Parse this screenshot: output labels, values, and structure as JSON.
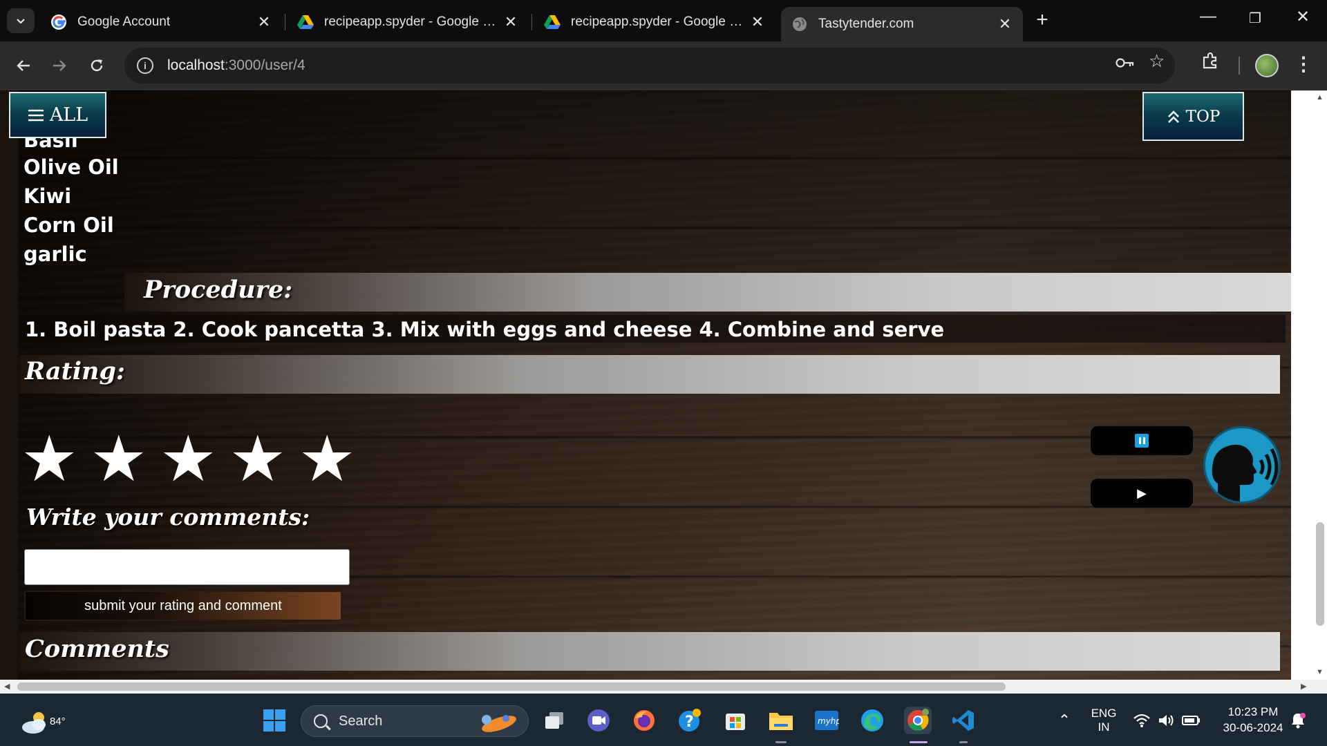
{
  "browser": {
    "tabs": [
      {
        "title": "Google Account",
        "icon": "google-icon"
      },
      {
        "title": "recipeapp.spyder - Google Drive",
        "icon": "google-drive-icon"
      },
      {
        "title": "recipeapp.spyder - Google Drive",
        "icon": "google-drive-icon"
      },
      {
        "title": "Tastytender.com",
        "icon": "globe-icon",
        "active": true
      }
    ],
    "url_host": "localhost",
    "url_path": ":3000/user/4"
  },
  "page": {
    "nav_all_label": "ALL",
    "nav_top_label": "TOP",
    "ingredients": [
      "Basil",
      "Olive Oil",
      "Kiwi",
      "Corn Oil",
      "garlic"
    ],
    "procedure_heading": "Procedure:",
    "procedure_text": "1. Boil pasta 2. Cook pancetta 3. Mix with eggs and cheese 4. Combine and serve",
    "rating_heading": "Rating:",
    "rating_stars": [
      "★",
      "★",
      "★",
      "★",
      "★"
    ],
    "comments_prompt": "Write your comments:",
    "comment_input_value": "",
    "submit_label": "submit your rating and comment",
    "comments_heading": "Comments",
    "tts_play_glyph": "▶"
  },
  "taskbar": {
    "weather_temp": "84°",
    "search_placeholder": "Search",
    "language_line1": "ENG",
    "language_line2": "IN",
    "time": "10:23 PM",
    "date": "30-06-2024"
  },
  "colors": {
    "accent_teal": "#0b3d4c",
    "tts_blue": "#1c98c7",
    "taskbar_bg": "#1b2733"
  }
}
